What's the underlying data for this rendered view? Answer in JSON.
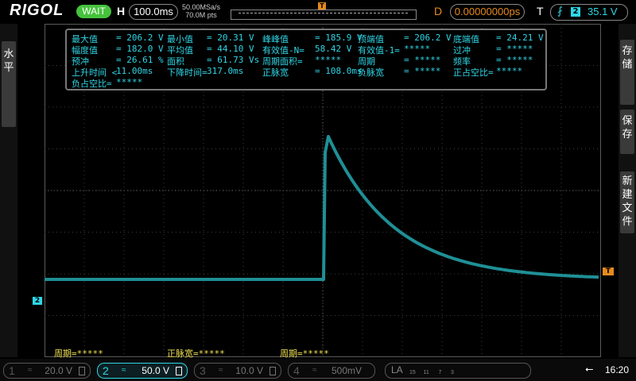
{
  "brand": "RIGOL",
  "status": "WAIT",
  "horizontal": {
    "label": "H",
    "timebase": "100.0ms",
    "sample_rate": "50.00MSa/s",
    "mem_depth": "70.0M pts"
  },
  "delay": {
    "label": "D",
    "value": "0.00000000ps"
  },
  "trigger": {
    "label": "T",
    "channel": "2",
    "level": "35.1 V",
    "marker": "T"
  },
  "left_panel": {
    "label": "水平"
  },
  "right_panel": {
    "save_label": "存储",
    "save_btn": "保存",
    "new_file_btn": "新建文件"
  },
  "measurements": [
    [
      {
        "label": "最大值",
        "value": "= 206.2 V"
      },
      {
        "label": "最小值",
        "value": "= 20.31 V"
      },
      {
        "label": "峰峰值",
        "value": "= 185.9 V"
      },
      {
        "label": "顶端值",
        "value": "= 206.2 V"
      },
      {
        "label": "底端值",
        "value": "= 24.21 V"
      }
    ],
    [
      {
        "label": "幅度值",
        "value": "= 182.0 V"
      },
      {
        "label": "平均值",
        "value": "= 44.10 V"
      },
      {
        "label": "有效值-N=",
        "value": "58.42 V"
      },
      {
        "label": "有效值-1=",
        "value": "*****"
      },
      {
        "label": "过冲",
        "value": "= *****"
      }
    ],
    [
      {
        "label": "预冲",
        "value": "= 26.61 %"
      },
      {
        "label": "面积",
        "value": "= 61.73 Vs"
      },
      {
        "label": "周期面积=",
        "value": "*****"
      },
      {
        "label": "周期",
        "value": "= *****"
      },
      {
        "label": "频率",
        "value": "= *****"
      }
    ],
    [
      {
        "label": "上升时间 <",
        "value": "11.00ms"
      },
      {
        "label": "下降时间=",
        "value": "317.0ms"
      },
      {
        "label": "正脉宽",
        "value": "= 108.0ms"
      },
      {
        "label": "负脉宽",
        "value": "= *****"
      },
      {
        "label": "正占空比=",
        "value": "*****"
      }
    ],
    [
      {
        "label": "负占空比=",
        "value": "*****"
      }
    ]
  ],
  "bottom_stats": [
    "周期=*****",
    "正脉宽=*****",
    "周期=*****"
  ],
  "ch2_marker": "2",
  "channels": [
    {
      "num": "1",
      "coupling": "≈",
      "scale": "20.0 V",
      "active": false
    },
    {
      "num": "2",
      "coupling": "≈",
      "scale": "50.0 V",
      "active": true
    },
    {
      "num": "3",
      "coupling": "≈",
      "scale": "10.0 V",
      "active": false
    },
    {
      "num": "4",
      "coupling": "≈",
      "scale": "500mV",
      "active": false
    }
  ],
  "la": {
    "label": "LA",
    "numbers": "15     11      7      3"
  },
  "clock": "16:20",
  "colors": {
    "ch2": "#2fd6e6",
    "trace": "#1f8f96",
    "trigger": "#e68a1e",
    "status": "#46c23c",
    "stats": "#f0e050"
  }
}
